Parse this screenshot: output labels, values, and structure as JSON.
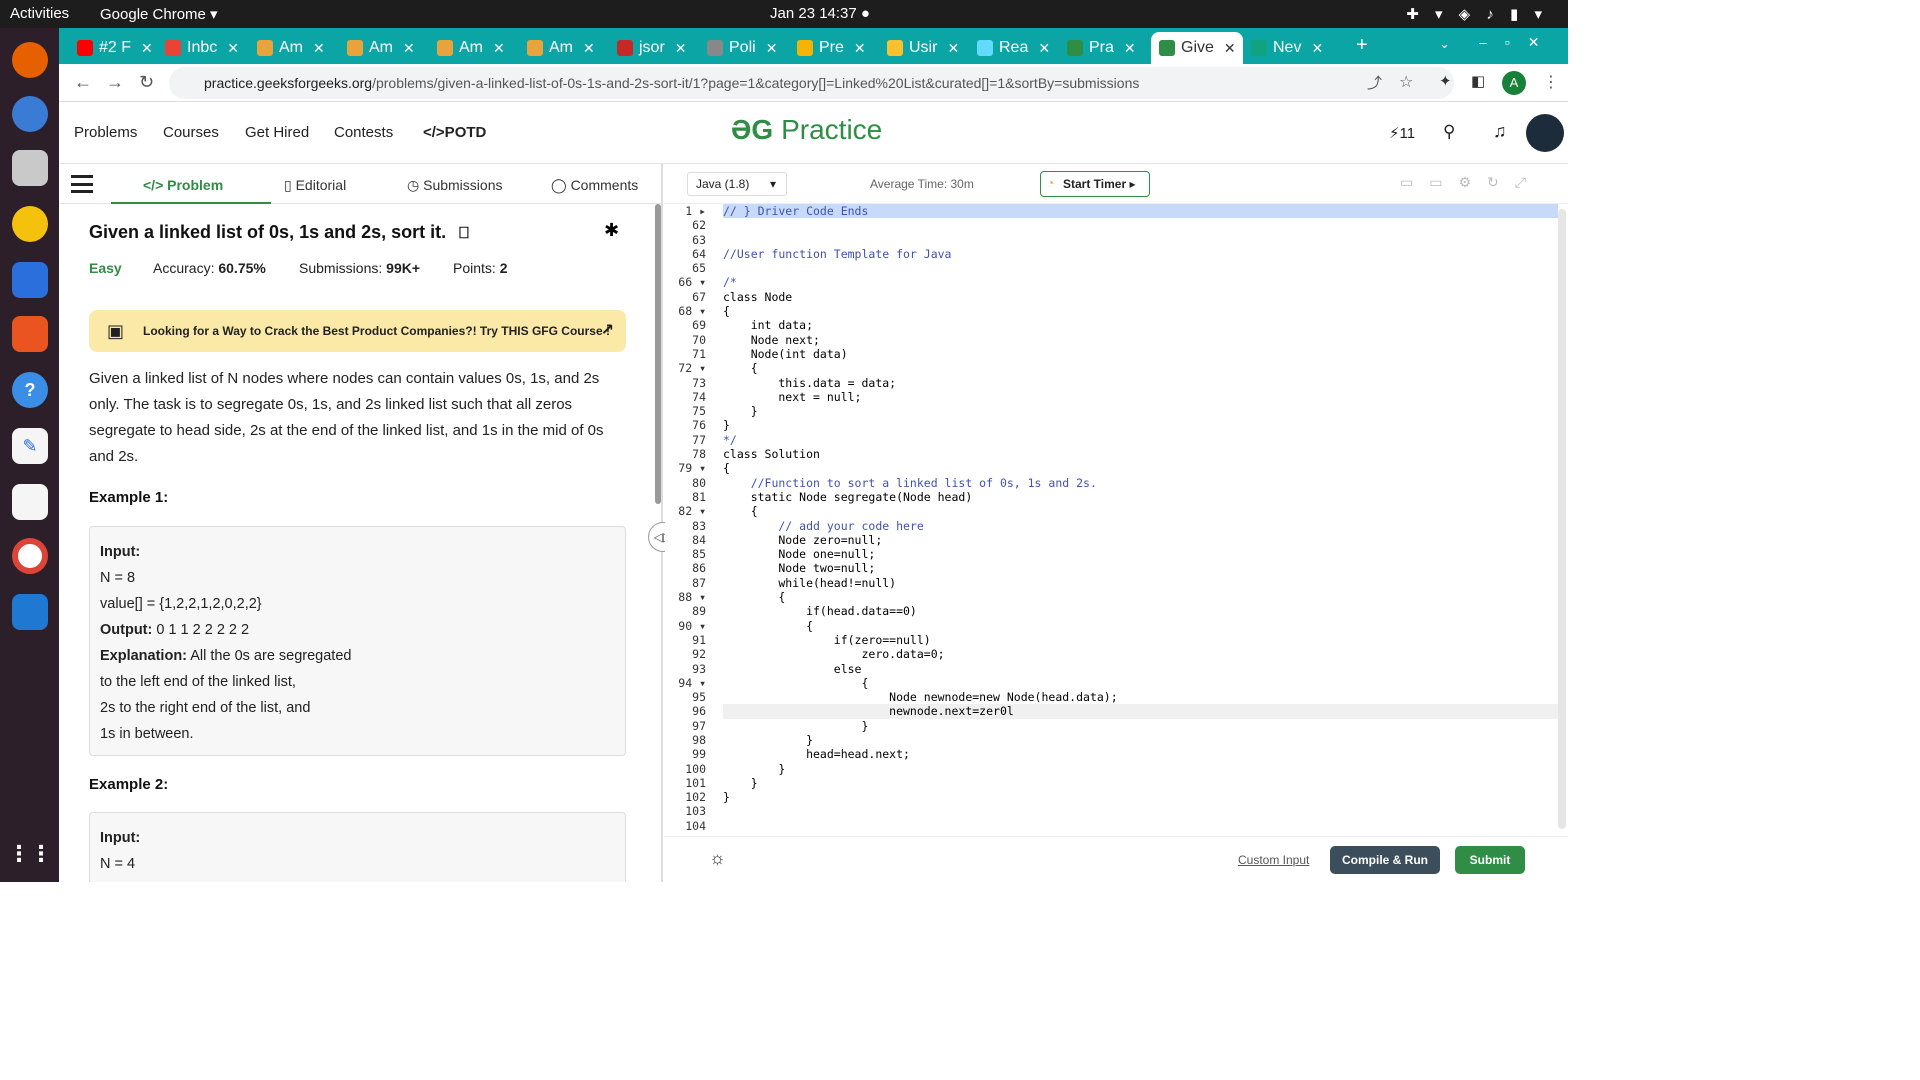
{
  "os": {
    "activities": "Activities",
    "app_name": "Google Chrome ▾",
    "clock": "Jan 23  14:37 ●"
  },
  "tabs": [
    {
      "label": "#2 F",
      "color": "#ff0000"
    },
    {
      "label": "Inbc",
      "color": "#ea4335"
    },
    {
      "label": "Am",
      "color": "#e8a33c"
    },
    {
      "label": "Am",
      "color": "#e8a33c"
    },
    {
      "label": "Am",
      "color": "#e8a33c"
    },
    {
      "label": "Am",
      "color": "#e8a33c"
    },
    {
      "label": "jsor",
      "color": "#c62828"
    },
    {
      "label": "Poli",
      "color": "#888888"
    },
    {
      "label": "Pre",
      "color": "#f4b400"
    },
    {
      "label": "Usir",
      "color": "#fbc02d"
    },
    {
      "label": "Rea",
      "color": "#61dafb"
    },
    {
      "label": "Pra",
      "color": "#2f8d46"
    },
    {
      "label": "Give",
      "color": "#2f8d46"
    },
    {
      "label": "Nev",
      "color": "#10a37f"
    }
  ],
  "browser": {
    "url_host": "practice.geeksforgeeks.org",
    "url_path": "/problems/given-a-linked-list-of-0s-1s-and-2s-sort-it/1?page=1&category[]=Linked%20List&curated[]=1&sortBy=submissions",
    "profile_initial": "A"
  },
  "gfg": {
    "nav": [
      "Problems",
      "Courses",
      "Get Hired",
      "Contests",
      "</>POTD"
    ],
    "brand_logo": "ƏG",
    "brand_text": "Practice",
    "streak": "⚡11"
  },
  "problem_tabs": [
    "</> Problem",
    "Editorial",
    "Submissions",
    "Comments"
  ],
  "problem": {
    "title": "Given a linked list of 0s, 1s and 2s, sort it.",
    "difficulty": "Easy",
    "accuracy_label": "Accuracy:",
    "accuracy": "60.75%",
    "submissions_label": "Submissions:",
    "submissions": "99K+",
    "points_label": "Points:",
    "points": "2",
    "banner": "Looking for a Way to Crack the Best Product Companies?! Try THIS GFG Course !",
    "description": "Given a linked list of N nodes where nodes can contain values 0s, 1s, and 2s only. The task is to segregate 0s, 1s, and 2s linked list such that all zeros segregate to head side, 2s at the end of the linked list, and 1s in the mid of 0s and 2s.",
    "example1_label": "Example 1:",
    "example1": {
      "input_label": "Input:",
      "n": "N = 8",
      "values": "value[] = {1,2,2,1,2,0,2,2}",
      "output_label": "Output:",
      "output": "0 1 1 2 2 2 2 2",
      "explanation_label": "Explanation:",
      "explanation_1": "All the 0s are segregated",
      "explanation_2": "to the left end of the linked list,",
      "explanation_3": "2s to the right end of the list, and",
      "explanation_4": "1s in between."
    },
    "example2_label": "Example 2:",
    "example2": {
      "input_label": "Input:",
      "n": "N = 4"
    }
  },
  "editor": {
    "language": "Java (1.8)",
    "avg_time": "Average Time: 30m",
    "start_timer": "Start Timer",
    "custom_input": "Custom Input",
    "compile_run": "Compile & Run",
    "submit": "Submit",
    "line_numbers": [
      "1 ▸",
      "62",
      "63",
      "64",
      "65",
      "66 ▾",
      "67",
      "68 ▾",
      "69",
      "70",
      "71",
      "72 ▾",
      "73",
      "74",
      "75",
      "76",
      "77",
      "78",
      "79 ▾",
      "80",
      "81",
      "82 ▾",
      "83",
      "84",
      "85",
      "86",
      "87",
      "88 ▾",
      "89",
      "90 ▾",
      "91",
      "92",
      "93",
      "94 ▾",
      "95",
      "96",
      "97",
      "98",
      "99",
      "100",
      "101",
      "102",
      "103",
      "104"
    ],
    "code_lines": [
      "// } Driver Code Ends",
      "",
      "",
      "//User function Template for Java",
      "",
      "/*",
      "class Node",
      "{",
      "    int data;",
      "    Node next;",
      "    Node(int data)",
      "    {",
      "        this.data = data;",
      "        next = null;",
      "    }",
      "}",
      "*/",
      "class Solution",
      "{",
      "    //Function to sort a linked list of 0s, 1s and 2s.",
      "    static Node segregate(Node head)",
      "    {",
      "        // add your code here",
      "        Node zero=null;",
      "        Node one=null;",
      "        Node two=null;",
      "        while(head!=null)",
      "        {",
      "            if(head.data==0)",
      "            {",
      "                if(zero==null)",
      "                    zero.data=0;",
      "                else",
      "                    {",
      "                        Node newnode=new Node(head.data);",
      "                        newnode.next=zer0l",
      "                    }",
      "            }",
      "            head=head.next;",
      "        }",
      "    }",
      "}",
      "",
      ""
    ]
  }
}
